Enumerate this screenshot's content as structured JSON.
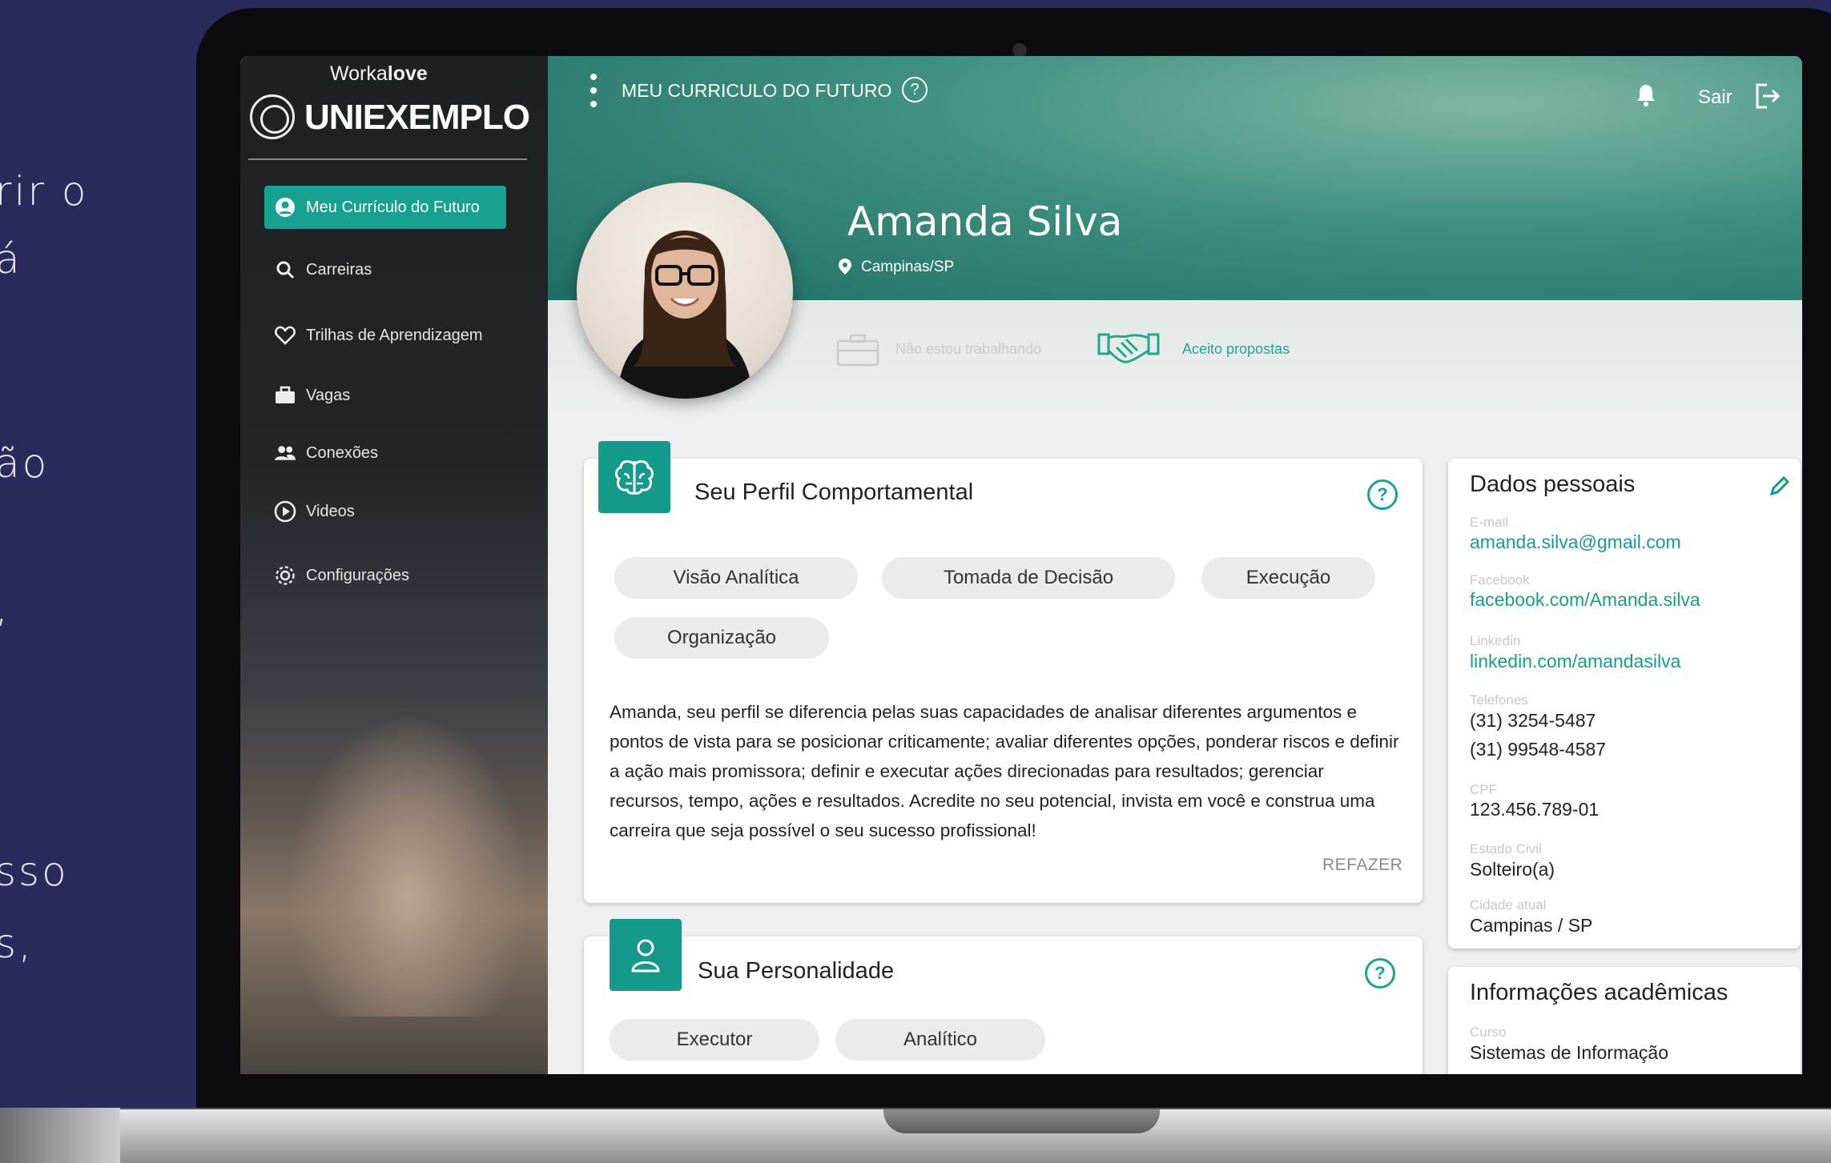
{
  "backdrop": {
    "lines": [
      "rir o",
      "á",
      "ão",
      ",",
      "sso",
      "s,"
    ]
  },
  "sidebar": {
    "brand_small_prefix": "Worka",
    "brand_small_bold": "love",
    "brand": "UNIEXEMPLO",
    "items": [
      {
        "label": "Meu Currículo do Futuro",
        "icon": "user-circle-icon",
        "active": true
      },
      {
        "label": "Carreiras",
        "icon": "search-icon"
      },
      {
        "label": "Trilhas de Aprendizagem",
        "icon": "heart-icon"
      },
      {
        "label": "Vagas",
        "icon": "briefcase-icon"
      },
      {
        "label": "Conexões",
        "icon": "people-icon"
      },
      {
        "label": "Videos",
        "icon": "play-circle-icon"
      },
      {
        "label": "Configurações",
        "icon": "gear-icon"
      }
    ]
  },
  "header": {
    "title": "MEU CURRICULO DO FUTURO",
    "logout": "Sair"
  },
  "profile": {
    "name": "Amanda Silva",
    "location": "Campinas/SP",
    "status_not_working": "Não estou trabalhando",
    "status_offers": "Aceito propostas"
  },
  "behavior": {
    "title": "Seu Perfil Comportamental",
    "tags": [
      "Visão Analítica",
      "Tomada de Decisão",
      "Execução",
      "Organização"
    ],
    "description": "Amanda, seu perfil se diferencia pelas suas capacidades de analisar diferentes argumentos e pontos de vista para se posicionar criticamente; avaliar diferentes opções, ponderar riscos e definir a ação mais promissora; definir e executar ações direcionadas para resultados; gerenciar recursos, tempo, ações e resultados. Acredite no seu potencial, invista em você e construa uma carreira que seja possível o seu sucesso profissional!",
    "redo": "REFAZER"
  },
  "personality": {
    "title": "Sua Personalidade",
    "tags": [
      "Executor",
      "Analítico"
    ]
  },
  "personal": {
    "title": "Dados pessoais",
    "email_label": "E-mail",
    "email": "amanda.silva@gmail.com",
    "facebook_label": "Facebook",
    "facebook": "facebook.com/Amanda.silva",
    "linkedin_label": "Linkedin",
    "linkedin": "linkedin.com/amandasilva",
    "phones_label": "Telefones",
    "phone1": "(31) 3254-5487",
    "phone2": "(31) 99548-4587",
    "cpf_label": "CPF",
    "cpf": "123.456.789-01",
    "civil_label": "Estado Civil",
    "civil": "Solteiro(a)",
    "city_label": "Cidade atual",
    "city": "Campinas / SP"
  },
  "academic": {
    "title": "Informações acadêmicas",
    "course_label": "Curso",
    "course": "Sistemas de Informação"
  },
  "colors": {
    "accent": "#16a191",
    "background": "#2b2a5c"
  }
}
